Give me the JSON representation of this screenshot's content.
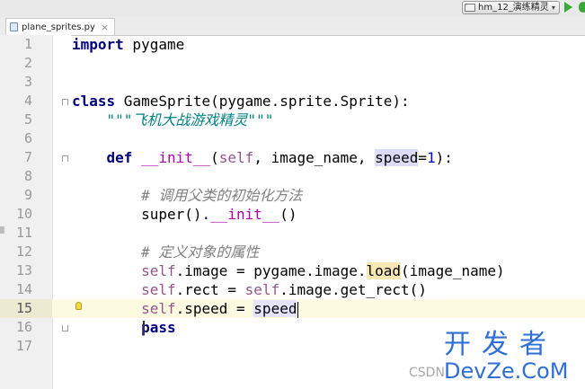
{
  "toolbar": {
    "run_config": "hm_12_演练精灵"
  },
  "tab": {
    "filename": "plane_sprites.py",
    "close": "×"
  },
  "editor": {
    "current_line": 15,
    "lines": [
      {
        "n": "1"
      },
      {
        "n": "2"
      },
      {
        "n": "3"
      },
      {
        "n": "4"
      },
      {
        "n": "5"
      },
      {
        "n": "6"
      },
      {
        "n": "7"
      },
      {
        "n": "8"
      },
      {
        "n": "9"
      },
      {
        "n": "10"
      },
      {
        "n": "11"
      },
      {
        "n": "12"
      },
      {
        "n": "13"
      },
      {
        "n": "14"
      },
      {
        "n": "15"
      },
      {
        "n": "16"
      },
      {
        "n": "17"
      }
    ],
    "tokens": {
      "l1_kw": "import",
      "l1_mod": " pygame",
      "l4_kw": "class",
      "l4_rest": " GameSprite(pygame.sprite.Sprite):",
      "l5_doc": "    \"\"\"飞机大战游戏精灵\"\"\"",
      "l7_indent": "    ",
      "l7_kw": "def",
      "l7_sp": " ",
      "l7_init": "__init__",
      "l7_paren": "(",
      "l7_self": "self",
      "l7_mid": ", image_name, ",
      "l7_speed": "speed",
      "l7_eq": "=",
      "l7_num": "1",
      "l7_end": "):",
      "l9_cmt": "        # 调用父类的初始化方法",
      "l10_indent": "        ",
      "l10_super": "super().",
      "l10_init": "__init__",
      "l10_end": "()",
      "l12_cmt": "        # 定义对象的属性",
      "l13_indent": "        ",
      "l13_self": "self",
      "l13_mid": ".image = pygame.image.",
      "l13_load": "load",
      "l13_end": "(image_name)",
      "l14_indent": "        ",
      "l14_self": "self",
      "l14_mid": ".rect = ",
      "l14_self2": "self",
      "l14_end": ".image.get_rect()",
      "l15_indent": "        ",
      "l15_self": "self",
      "l15_mid": ".speed = ",
      "l15_speed": "speed",
      "l16_indent": "        ",
      "l16_kw": "pass"
    }
  },
  "watermark": {
    "top": "开发者",
    "bottom": "DevZe.CoM",
    "csdn": "CSDN"
  },
  "colors": {
    "keyword": "#000080",
    "self": "#94558d",
    "number": "#0000ff",
    "docstring": "#008080",
    "comment": "#808080",
    "magic": "#b200b2",
    "current_line": "#fcfae0",
    "watermark": "#2f6fd6"
  }
}
